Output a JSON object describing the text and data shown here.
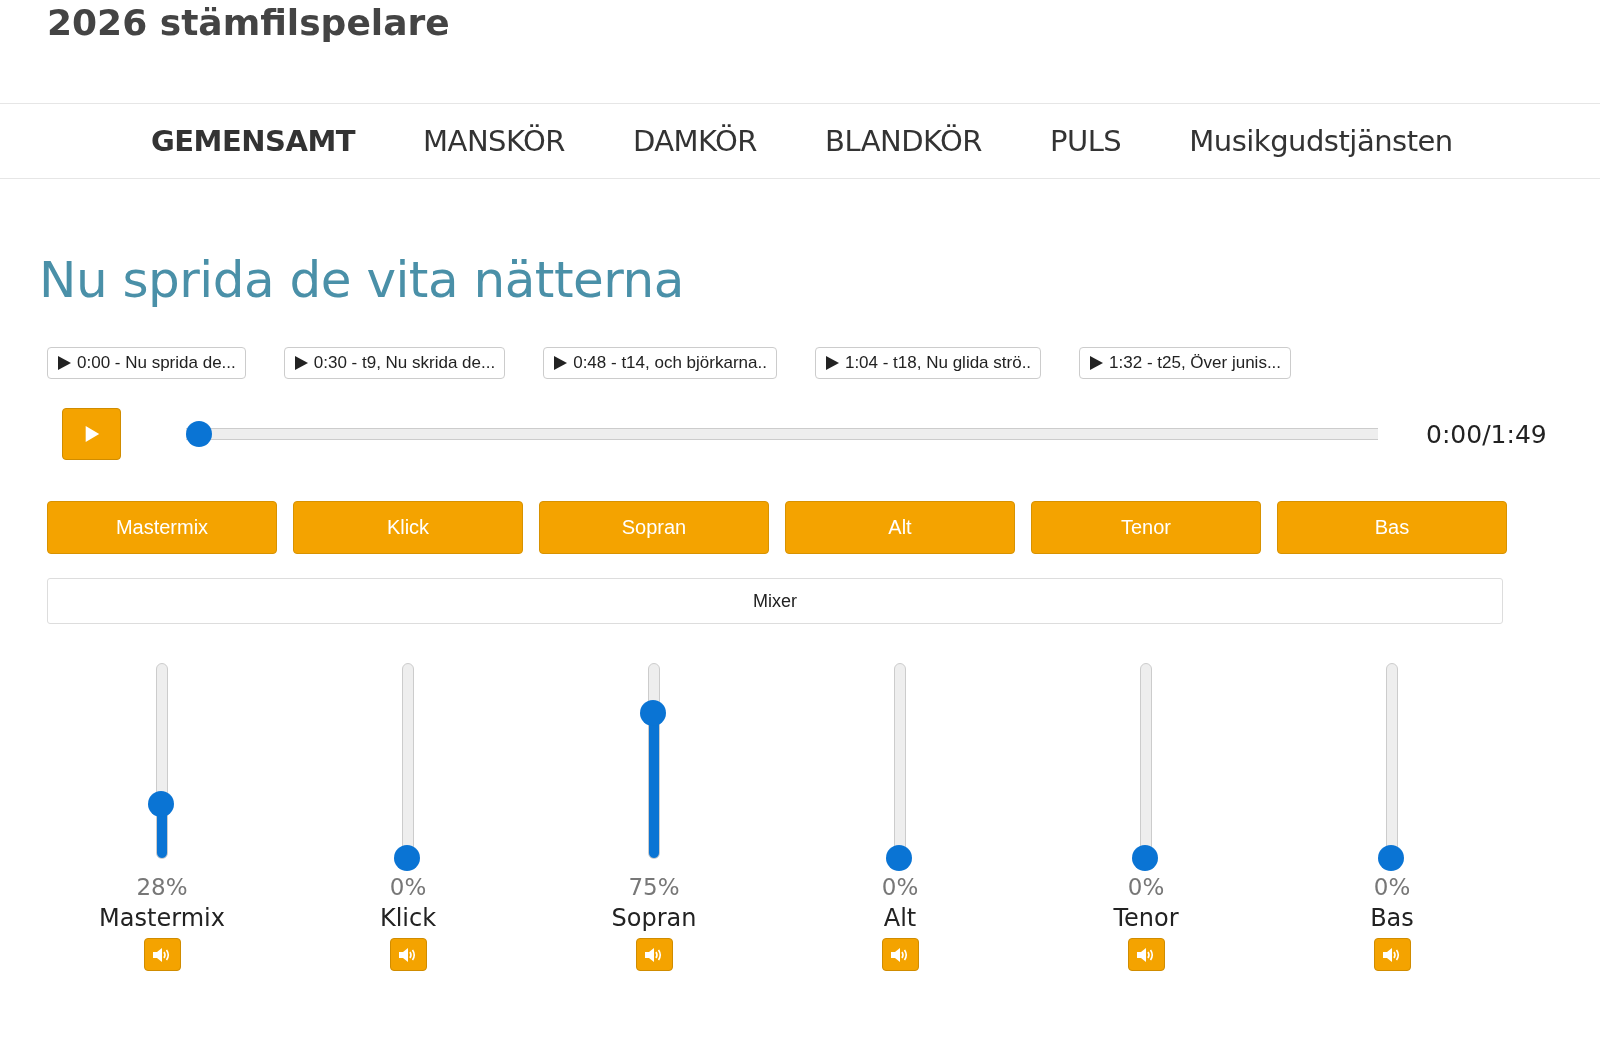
{
  "site_title": "2026 stämfilspelare",
  "nav": [
    {
      "label": "GEMENSAMT",
      "selected": true
    },
    {
      "label": "MANSKÖR",
      "selected": false
    },
    {
      "label": "DAMKÖR",
      "selected": false
    },
    {
      "label": "BLANDKÖR",
      "selected": false
    },
    {
      "label": "PULS",
      "selected": false
    },
    {
      "label": "Musikgudstjänsten",
      "selected": false
    }
  ],
  "song_title": "Nu sprida de vita nätterna",
  "chapters": [
    "0:00 - Nu sprida de...",
    "0:30 - t9, Nu skrida de...",
    "0:48 - t14, och björkarna..",
    "1:04 - t18, Nu glida strö..",
    "1:32 - t25, Över junis..."
  ],
  "player": {
    "level": 0,
    "time": "0:00/1:49"
  },
  "parts": [
    "Mastermix",
    "Klick",
    "Sopran",
    "Alt",
    "Tenor",
    "Bas"
  ],
  "mixer_label": "Mixer",
  "channels": [
    {
      "name": "Mastermix",
      "level": 0.28,
      "reading": "28%"
    },
    {
      "name": "Klick",
      "level": 0,
      "reading": "0%"
    },
    {
      "name": "Sopran",
      "level": 0.75,
      "reading": "75%"
    },
    {
      "name": "Alt",
      "level": 0,
      "reading": "0%"
    },
    {
      "name": "Tenor",
      "level": 0,
      "reading": "0%"
    },
    {
      "name": "Bas",
      "level": 0,
      "reading": "0%"
    }
  ]
}
